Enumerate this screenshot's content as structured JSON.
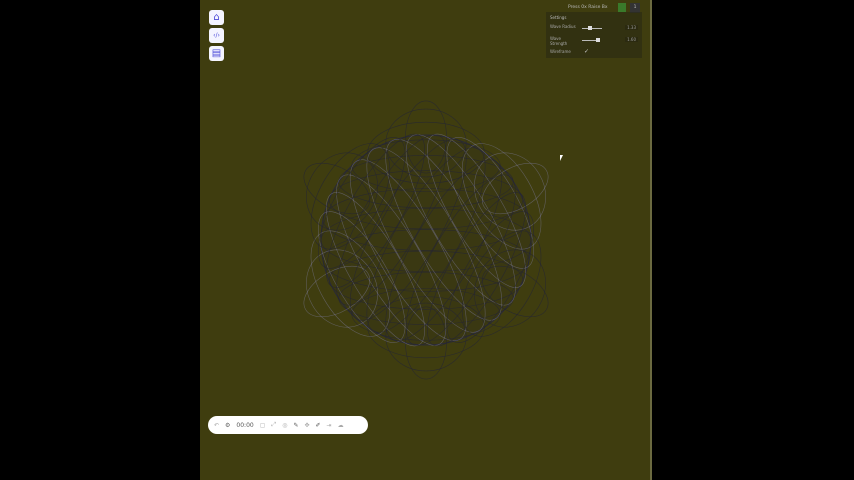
{
  "colors": {
    "background": "#3f3d0f",
    "accent": "#4a48d8",
    "wire": "#2a2a36"
  },
  "sidebar": {
    "items": [
      {
        "icon": "home-icon",
        "glyph": "⌂"
      },
      {
        "icon": "code-icon",
        "glyph": "‹/›"
      },
      {
        "icon": "file-icon",
        "glyph": "▤"
      }
    ]
  },
  "topbar": {
    "title": "Press 0x Raise Bx",
    "badge_icon": "cactus-icon",
    "button_glyph": "1"
  },
  "settings": {
    "title": "Settings",
    "params": [
      {
        "label": "Wave Radius",
        "value": "1.33",
        "fraction": 0.35
      },
      {
        "label": "Wave Strength",
        "value": "1.60",
        "fraction": 0.8
      }
    ],
    "wireframe_label": "Wireframe",
    "wireframe": true
  },
  "toolbar": {
    "time": "00:00",
    "items": [
      "undo-icon",
      "clock-icon",
      "frame-icon",
      "expand-icon",
      "settings-icon",
      "pen-icon",
      "move-icon",
      "brush-icon",
      "share-icon",
      "cloud-icon"
    ]
  }
}
